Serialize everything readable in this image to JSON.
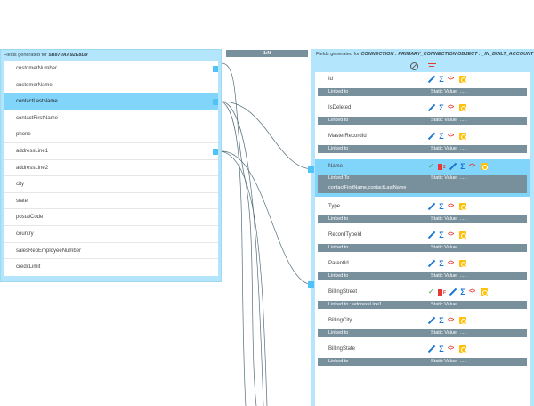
{
  "left_panel": {
    "title_prefix": "Fields generated for",
    "title_id": "5B870AA92E8D9",
    "fields": [
      "customerNumber",
      "customerName",
      "contactLastName",
      "contactFirstName",
      "phone",
      "addressLine1",
      "addressLine2",
      "city",
      "state",
      "postalCode",
      "country",
      "salesRepEmployeeNumber",
      "creditLimit"
    ],
    "selected_field": "contactLastName"
  },
  "relation": {
    "label": "1:N"
  },
  "right_panel": {
    "title_prefix": "Fields generated for",
    "title_object": "CONNECTION : PRIMARY_CONNECTION OBJECT : _IN_BUILT_ACCOUNT",
    "tools": [
      "ban-icon",
      "filter-icon"
    ],
    "fields": [
      {
        "name": "Id",
        "linked_to": "Linked to",
        "static_value": "Static Value",
        "dots": "....."
      },
      {
        "name": "IsDeleted",
        "linked_to": "Linked to",
        "static_value": "Static Value",
        "dots": "....."
      },
      {
        "name": "MasterRecordId",
        "linked_to": "Linked to",
        "static_value": "Static Value",
        "dots": "....."
      },
      {
        "name": "Name",
        "linked_to": "Linked To",
        "static_value": "Static Value",
        "dots": ".....",
        "mapped": "contactFirstName,contactLastName",
        "selected": true
      },
      {
        "name": "Type",
        "linked_to": "Linked to",
        "static_value": "Static Value",
        "dots": "....."
      },
      {
        "name": "RecordTypeId",
        "linked_to": "Linked to",
        "static_value": "Static Value",
        "dots": "....."
      },
      {
        "name": "ParentId",
        "linked_to": "Linked to",
        "static_value": "Static Value",
        "dots": "....."
      },
      {
        "name": "BillingStreet",
        "linked_to": "Linked to : addressLine1",
        "static_value": "Static Value",
        "dots": "....."
      },
      {
        "name": "BillingCity",
        "linked_to": "Linked to",
        "static_value": "Static Value",
        "dots": "....."
      },
      {
        "name": "BillingState",
        "linked_to": "Linked to",
        "static_value": "Static Value",
        "dots": "....."
      }
    ],
    "trash_badge": "2",
    "trash_badge_f": "F"
  }
}
